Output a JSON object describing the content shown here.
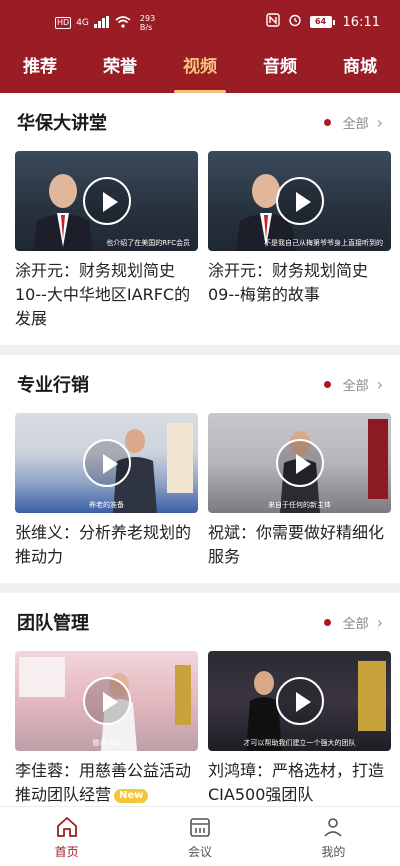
{
  "status_bar": {
    "left_badge": "HD",
    "network": "4G",
    "speed_value": "293",
    "speed_unit": "B/s",
    "battery": "64",
    "time": "16:11"
  },
  "tabs": [
    {
      "label": "推荐"
    },
    {
      "label": "荣誉"
    },
    {
      "label": "视频",
      "active": true
    },
    {
      "label": "音频"
    },
    {
      "label": "商城"
    }
  ],
  "more_label": "全部",
  "sections": [
    {
      "title": "华保大讲堂",
      "cards": [
        {
          "title": "涂开元：财务规划简史10--大中华地区IARFC的发展",
          "caption": "也介绍了在美国的RFC会员"
        },
        {
          "title": "涂开元：财务规划简史09--梅第的故事",
          "caption": "不是我自己从梅第爷爷身上直接听到的"
        }
      ]
    },
    {
      "title": "专业行销",
      "cards": [
        {
          "title": "张维义：分析养老规划的推动力",
          "caption": "养老的准备"
        },
        {
          "title": "祝斌：你需要做好精细化服务",
          "caption": "来自于任何的新主体"
        }
      ]
    },
    {
      "title": "团队管理",
      "cards": [
        {
          "title": "李佳蓉：用慈善公益活动推动团队经营",
          "badge": "New",
          "caption": "慈善活动"
        },
        {
          "title": "刘鸿璋：严格选材，打造CIA500强团队",
          "caption": "才可以帮助我们建立一个强大的团队"
        }
      ]
    }
  ],
  "bottom_nav": [
    {
      "label": "首页",
      "icon": "home-icon",
      "active": true
    },
    {
      "label": "会议",
      "icon": "calendar-icon"
    },
    {
      "label": "我的",
      "icon": "user-icon"
    }
  ],
  "colors": {
    "brand": "#9a1d26",
    "accent": "#f3c27a",
    "dot": "#b4121f"
  }
}
